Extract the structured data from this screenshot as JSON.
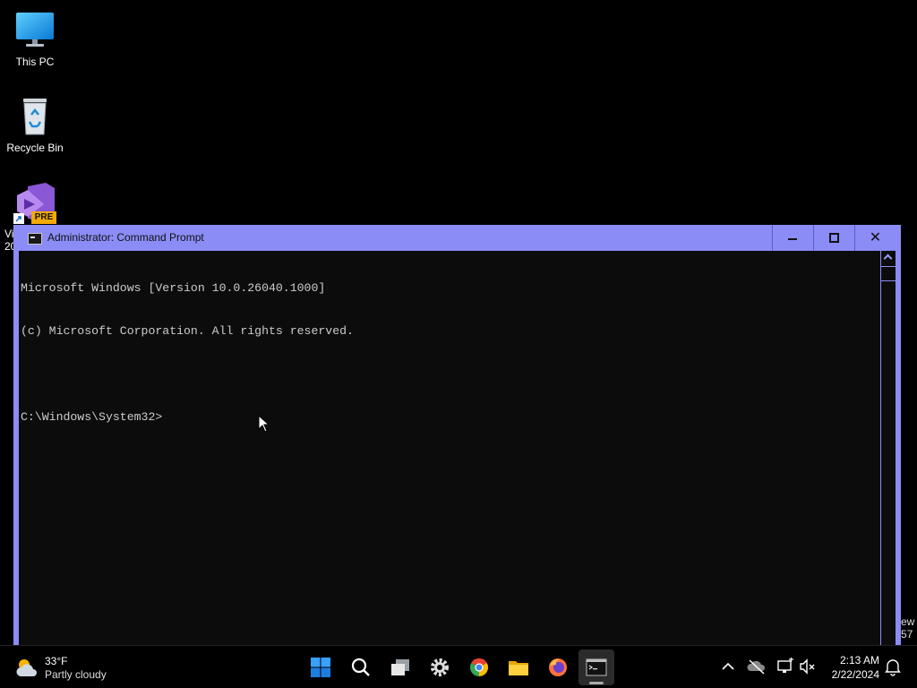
{
  "desktop": {
    "icons": [
      {
        "label": "This PC"
      },
      {
        "label": "Recycle Bin"
      },
      {
        "label": "Vi\n20",
        "badge": "PRE"
      }
    ],
    "edge_text_right": "ew\n57"
  },
  "window": {
    "title": "Administrator: Command Prompt",
    "minimize_label": "minimize",
    "maximize_label": "maximize",
    "close_glyph": "✕",
    "console_lines": [
      "Microsoft Windows [Version 10.0.26040.1000]",
      "(c) Microsoft Corporation. All rights reserved.",
      "",
      "C:\\Windows\\System32>"
    ],
    "accent_color": "#8b8cf5"
  },
  "taskbar": {
    "weather": {
      "temp": "33°F",
      "condition": "Partly cloudy"
    },
    "apps": [
      {
        "name": "start"
      },
      {
        "name": "search"
      },
      {
        "name": "task-view"
      },
      {
        "name": "settings"
      },
      {
        "name": "chrome"
      },
      {
        "name": "file-explorer"
      },
      {
        "name": "firefox"
      },
      {
        "name": "command-prompt",
        "active": true
      }
    ],
    "clock": {
      "time": "2:13 AM",
      "date": "2/22/2024"
    }
  }
}
